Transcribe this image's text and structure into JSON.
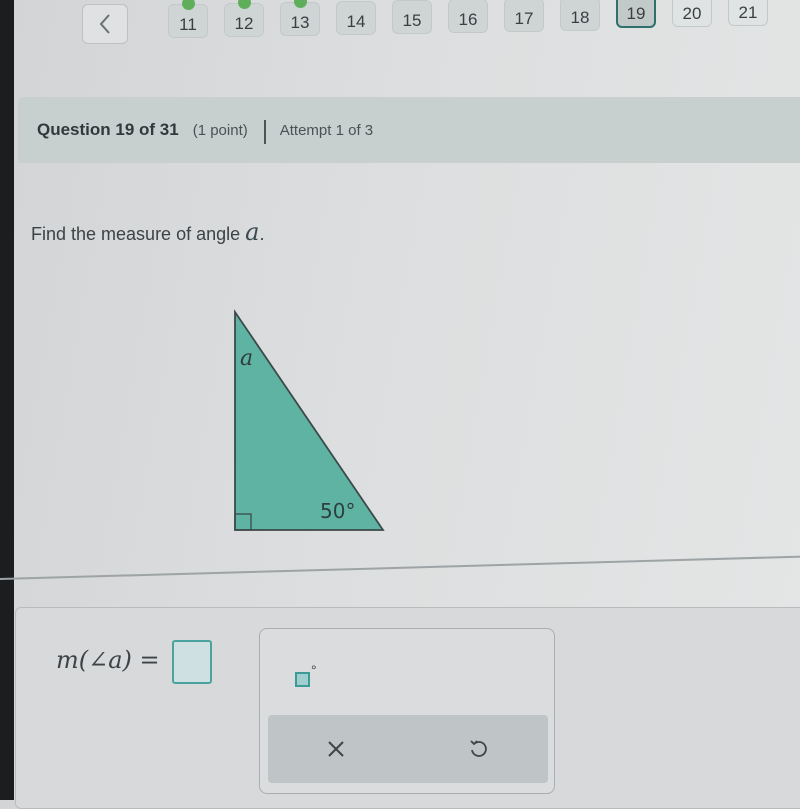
{
  "nav": {
    "back_icon": "chevron-left-icon",
    "questions": [
      {
        "label": "11",
        "answered": true
      },
      {
        "label": "12",
        "answered": true
      },
      {
        "label": "13",
        "answered": true
      },
      {
        "label": "14",
        "answered": false
      },
      {
        "label": "15",
        "answered": false
      },
      {
        "label": "16",
        "answered": false
      },
      {
        "label": "17",
        "answered": false
      },
      {
        "label": "18",
        "answered": false
      },
      {
        "label": "19",
        "answered": false,
        "current": true
      },
      {
        "label": "20",
        "answered": false
      },
      {
        "label": "21",
        "answered": false
      }
    ]
  },
  "header": {
    "title": "Question 19 of 31",
    "points": "(1 point)",
    "attempt": "Attempt 1 of 3"
  },
  "question": {
    "prompt": "Find the measure of angle ",
    "variable": "a",
    "period": "."
  },
  "diagram": {
    "angle_label_top": "a",
    "angle_label_bottom": "50°",
    "right_angle": true,
    "fill_color": "#5fb3a3",
    "stroke_color": "#3c4a4a"
  },
  "answer": {
    "expression": "m(∠a) =",
    "value": "",
    "keypad": {
      "degree_key": "□°",
      "clear_icon": "close-icon",
      "undo_icon": "undo-icon"
    }
  },
  "colors": {
    "accent": "#4ba3a0",
    "current_border": "#2f6f6c",
    "answered_dot": "#5fae5a"
  }
}
